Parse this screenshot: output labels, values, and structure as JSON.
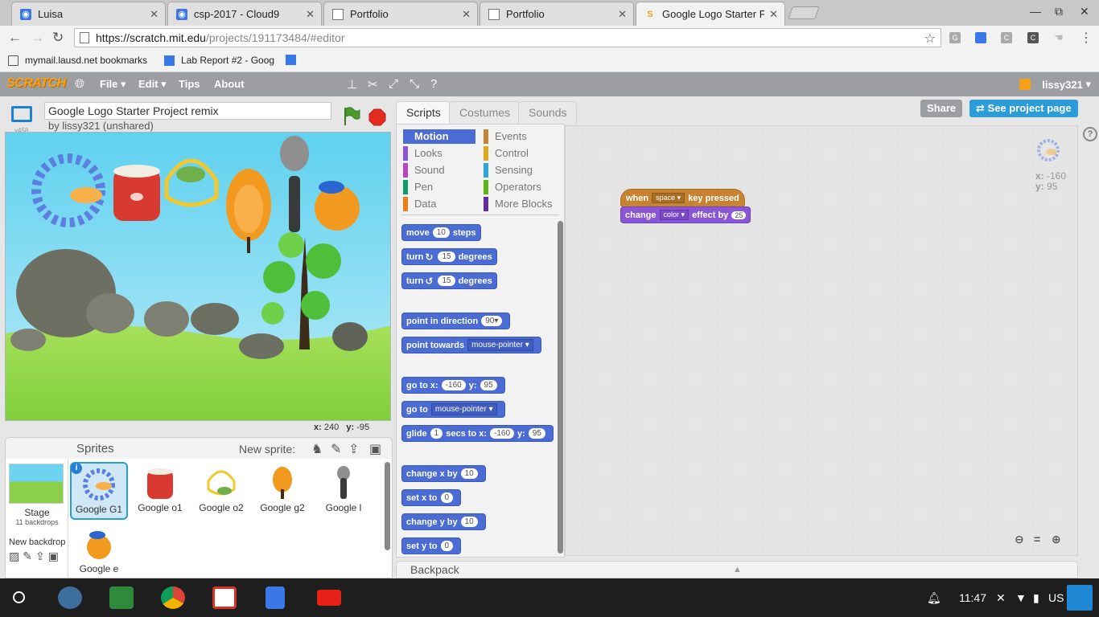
{
  "browser": {
    "tabs": [
      {
        "title": "Luisa"
      },
      {
        "title": "csp-2017 - Cloud9"
      },
      {
        "title": "Portfolio"
      },
      {
        "title": "Portfolio"
      },
      {
        "title": "Google Logo Starter Proj"
      }
    ],
    "url_host": "https://scratch.mit.edu",
    "url_rest": "/projects/191173484/#editor",
    "bookmarks": [
      {
        "label": "mymail.lausd.net bookmarks"
      },
      {
        "label": "Lab Report #2 - Goog"
      }
    ]
  },
  "scratch_menu": {
    "logo": "SCRATCH",
    "file": "File",
    "edit": "Edit",
    "tips": "Tips",
    "about": "About",
    "username": "lissy321"
  },
  "project": {
    "title": "Google Logo Starter Project remix",
    "byline": "by lissy321 (unshared)",
    "version": "v458",
    "share": "Share",
    "see_project_page": "See project page"
  },
  "stage": {
    "mouse_x_label": "x:",
    "mouse_x": "240",
    "mouse_y_label": "y:",
    "mouse_y": "-95"
  },
  "sprites_pane": {
    "title": "Sprites",
    "new_sprite": "New sprite:",
    "stage_label": "Stage",
    "backdrops": "11 backdrops",
    "new_backdrop": "New backdrop",
    "sprites": [
      {
        "name": "Google G1",
        "selected": true
      },
      {
        "name": "Google o1"
      },
      {
        "name": "Google o2"
      },
      {
        "name": "Google g2"
      },
      {
        "name": "Google l"
      },
      {
        "name": "Google e"
      }
    ]
  },
  "editor_tabs": {
    "scripts": "Scripts",
    "costumes": "Costumes",
    "sounds": "Sounds"
  },
  "categories": [
    {
      "label": "Motion",
      "color": "#4a6cd4"
    },
    {
      "label": "Looks",
      "color": "#8a55d7"
    },
    {
      "label": "Sound",
      "color": "#bb42c3"
    },
    {
      "label": "Pen",
      "color": "#0e9a6c"
    },
    {
      "label": "Data",
      "color": "#ee7d16"
    },
    {
      "label": "Events",
      "color": "#c88330"
    },
    {
      "label": "Control",
      "color": "#e1a91a"
    },
    {
      "label": "Sensing",
      "color": "#2ca5e2"
    },
    {
      "label": "Operators",
      "color": "#5cb712"
    },
    {
      "label": "More Blocks",
      "color": "#632d99"
    }
  ],
  "blocks": {
    "move": "move",
    "move_val": "10",
    "steps": "steps",
    "turn": "turn",
    "turn_val": "15",
    "degrees": "degrees",
    "point_dir": "point in direction",
    "point_dir_val": "90▾",
    "point_towards": "point towards",
    "pointer": "mouse-pointer",
    "goto": "go to x:",
    "goto_x": "-160",
    "y": "y:",
    "goto_y": "95",
    "goto_sprite": "go to",
    "glide": "glide",
    "glide_val": "1",
    "secs_to_x": "secs to x:",
    "change_x": "change x by",
    "change_val": "10",
    "set_x": "set x to",
    "set_val": "0",
    "change_y": "change y by",
    "set_y": "set y to"
  },
  "script": {
    "when": "when",
    "key": "space",
    "key_pressed": "key pressed",
    "change": "change",
    "effect": "color",
    "effect_by": "effect by",
    "amount": "25"
  },
  "script_area": {
    "x_label": "x:",
    "x": "-160",
    "y_label": "y:",
    "y": "95"
  },
  "backpack": "Backpack",
  "shelf": {
    "time": "11:47",
    "locale": "US"
  }
}
